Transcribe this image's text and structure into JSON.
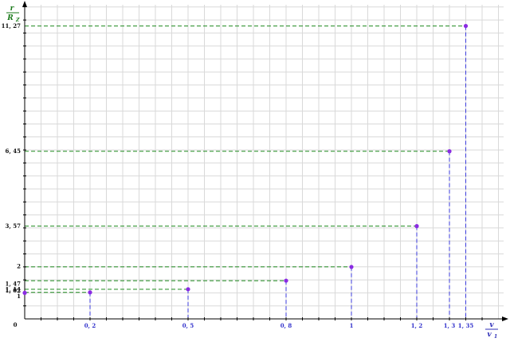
{
  "chart_data": {
    "type": "scatter",
    "title": "",
    "y_axis_label": {
      "numerator": "r",
      "denominator": "R",
      "denominator_sub": "Z"
    },
    "x_axis_label": {
      "numerator": "v",
      "denominator": "v",
      "denominator_sub": "1"
    },
    "xlim": [
      0,
      1.48
    ],
    "ylim": [
      0,
      12.1
    ],
    "origin_label": "0",
    "grid": true,
    "points": [
      {
        "x": 0,
        "y": 1
      },
      {
        "x": 0.2,
        "y": 1.02
      },
      {
        "x": 0.5,
        "y": 1.14
      },
      {
        "x": 0.8,
        "y": 1.47
      },
      {
        "x": 1,
        "y": 2
      },
      {
        "x": 1.2,
        "y": 3.57
      },
      {
        "x": 1.3,
        "y": 6.45
      },
      {
        "x": 1.35,
        "y": 11.27
      }
    ],
    "x_tick_labels": [
      {
        "value": 0.2,
        "label": "0, 2"
      },
      {
        "value": 0.5,
        "label": "0, 5"
      },
      {
        "value": 0.8,
        "label": "0, 8"
      },
      {
        "value": 1,
        "label": "1"
      },
      {
        "value": 1.2,
        "label": "1, 2"
      },
      {
        "value": 1.3,
        "label": "1, 3"
      },
      {
        "value": 1.35,
        "label": "1, 35"
      }
    ],
    "y_tick_labels": [
      {
        "value": 1,
        "label": "1"
      },
      {
        "value": 1.02,
        "label": "1, 02"
      },
      {
        "value": 1.14,
        "label": "1, 14"
      },
      {
        "value": 1.47,
        "label": "1, 47"
      },
      {
        "value": 2,
        "label": "2"
      },
      {
        "value": 3.57,
        "label": "3, 57"
      },
      {
        "value": 6.45,
        "label": "6, 45"
      },
      {
        "value": 11.27,
        "label": "11, 27"
      }
    ],
    "colors": {
      "points": "#8a2be2",
      "horizontal_guides": "#1f8a1f",
      "vertical_guides": "#3b3bdc",
      "x_tick_labels": "#3333cc",
      "y_axis_title": "#1a7a1a",
      "x_axis_title": "#2f2fb8",
      "grid": "#d9d9d9"
    }
  }
}
